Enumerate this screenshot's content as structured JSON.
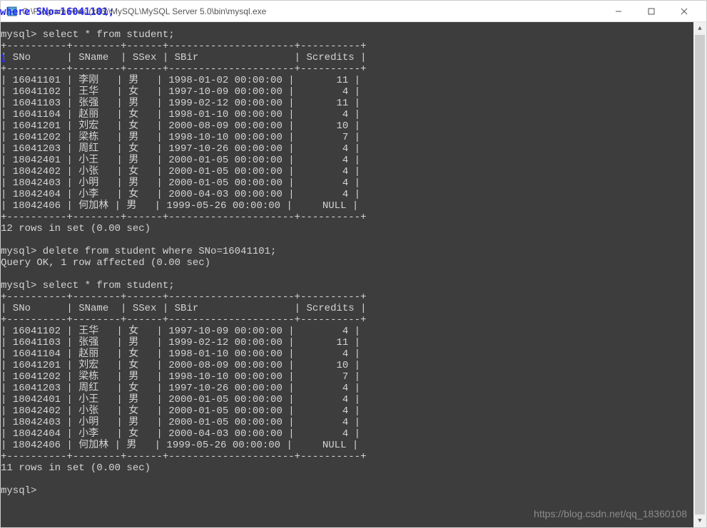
{
  "window": {
    "title": "C:\\Program Files (x86)\\MySQL\\MySQL Server 5.0\\bin\\mysql.exe"
  },
  "overlay": {
    "where_text": "where SNo=16041101; ",
    "left_num": "1"
  },
  "prompts": {
    "p1": "mysql> select * from student;",
    "p2": "mysql> delete from student where SNo=16041101;",
    "p2_result": "Query OK, 1 row affected (0.00 sec)",
    "p3": "mysql> select * from student;",
    "p4": "mysql> "
  },
  "headers": {
    "c1": "SNo",
    "c2": "SName",
    "c3": "SSex",
    "c4": "SBir",
    "c5": "Scredits"
  },
  "divider": "+----------+--------+------+---------------------+----------+",
  "table1": {
    "rows": [
      {
        "sno": "16041101",
        "sname": "李刚",
        "ssex": "男",
        "sbir": "1998-01-02 00:00:00",
        "scredits": "11"
      },
      {
        "sno": "16041102",
        "sname": "王华",
        "ssex": "女",
        "sbir": "1997-10-09 00:00:00",
        "scredits": "4"
      },
      {
        "sno": "16041103",
        "sname": "张强",
        "ssex": "男",
        "sbir": "1999-02-12 00:00:00",
        "scredits": "11"
      },
      {
        "sno": "16041104",
        "sname": "赵丽",
        "ssex": "女",
        "sbir": "1998-01-10 00:00:00",
        "scredits": "4"
      },
      {
        "sno": "16041201",
        "sname": "刘宏",
        "ssex": "女",
        "sbir": "2000-08-09 00:00:00",
        "scredits": "10"
      },
      {
        "sno": "16041202",
        "sname": "梁栋",
        "ssex": "男",
        "sbir": "1998-10-10 00:00:00",
        "scredits": "7"
      },
      {
        "sno": "16041203",
        "sname": "周红",
        "ssex": "女",
        "sbir": "1997-10-26 00:00:00",
        "scredits": "4"
      },
      {
        "sno": "18042401",
        "sname": "小王",
        "ssex": "男",
        "sbir": "2000-01-05 00:00:00",
        "scredits": "4"
      },
      {
        "sno": "18042402",
        "sname": "小张",
        "ssex": "女",
        "sbir": "2000-01-05 00:00:00",
        "scredits": "4"
      },
      {
        "sno": "18042403",
        "sname": "小明",
        "ssex": "男",
        "sbir": "2000-01-05 00:00:00",
        "scredits": "4"
      },
      {
        "sno": "18042404",
        "sname": "小李",
        "ssex": "女",
        "sbir": "2000-04-03 00:00:00",
        "scredits": "4"
      },
      {
        "sno": "18042406",
        "sname": "何加林",
        "ssex": "男",
        "sbir": "1999-05-26 00:00:00",
        "scredits": "NULL"
      }
    ],
    "summary": "12 rows in set (0.00 sec)"
  },
  "table2": {
    "rows": [
      {
        "sno": "16041102",
        "sname": "王华",
        "ssex": "女",
        "sbir": "1997-10-09 00:00:00",
        "scredits": "4"
      },
      {
        "sno": "16041103",
        "sname": "张强",
        "ssex": "男",
        "sbir": "1999-02-12 00:00:00",
        "scredits": "11"
      },
      {
        "sno": "16041104",
        "sname": "赵丽",
        "ssex": "女",
        "sbir": "1998-01-10 00:00:00",
        "scredits": "4"
      },
      {
        "sno": "16041201",
        "sname": "刘宏",
        "ssex": "女",
        "sbir": "2000-08-09 00:00:00",
        "scredits": "10"
      },
      {
        "sno": "16041202",
        "sname": "梁栋",
        "ssex": "男",
        "sbir": "1998-10-10 00:00:00",
        "scredits": "7"
      },
      {
        "sno": "16041203",
        "sname": "周红",
        "ssex": "女",
        "sbir": "1997-10-26 00:00:00",
        "scredits": "4"
      },
      {
        "sno": "18042401",
        "sname": "小王",
        "ssex": "男",
        "sbir": "2000-01-05 00:00:00",
        "scredits": "4"
      },
      {
        "sno": "18042402",
        "sname": "小张",
        "ssex": "女",
        "sbir": "2000-01-05 00:00:00",
        "scredits": "4"
      },
      {
        "sno": "18042403",
        "sname": "小明",
        "ssex": "男",
        "sbir": "2000-01-05 00:00:00",
        "scredits": "4"
      },
      {
        "sno": "18042404",
        "sname": "小李",
        "ssex": "女",
        "sbir": "2000-04-03 00:00:00",
        "scredits": "4"
      },
      {
        "sno": "18042406",
        "sname": "何加林",
        "ssex": "男",
        "sbir": "1999-05-26 00:00:00",
        "scredits": "NULL"
      }
    ],
    "summary": "11 rows in set (0.00 sec)"
  },
  "watermark": "https://blog.csdn.net/qq_18360108"
}
